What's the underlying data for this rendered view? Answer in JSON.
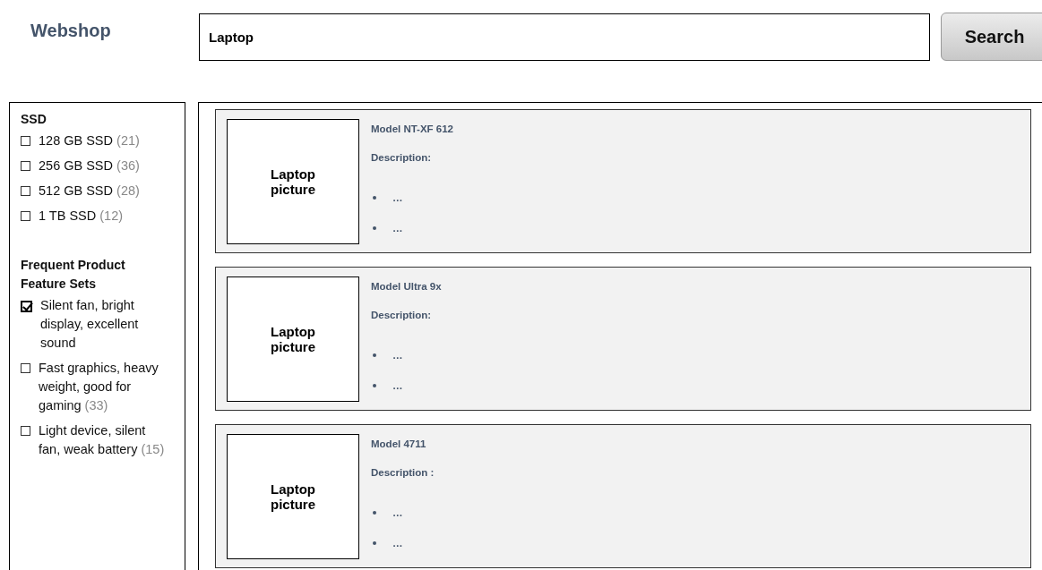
{
  "header": {
    "logo": "Webshop",
    "search": {
      "value": "Laptop"
    },
    "search_button": "Search"
  },
  "sidebar": {
    "groups": [
      {
        "title": "SSD",
        "options": [
          {
            "label": "128 GB SSD",
            "count": "(21)",
            "checked": false
          },
          {
            "label": "256 GB SSD",
            "count": "(36)",
            "checked": false
          },
          {
            "label": "512 GB SSD",
            "count": "(28)",
            "checked": false
          },
          {
            "label": "1 TB SSD",
            "count": "(12)",
            "checked": false
          }
        ]
      },
      {
        "title": "Frequent Product Feature Sets",
        "options": [
          {
            "label": "Silent fan, bright display, excellent sound",
            "checked": true
          },
          {
            "label": "Fast graphics, heavy weight, good for gaming",
            "count": "(33)",
            "checked": false
          },
          {
            "label": "Light device, silent fan, weak battery",
            "count": "(15)",
            "checked": false
          }
        ]
      }
    ]
  },
  "products": [
    {
      "picture_label": "Laptop picture",
      "model": "Model NT-XF 612",
      "description_label": "Description:",
      "bullets": [
        "…",
        "…"
      ]
    },
    {
      "picture_label": "Laptop picture",
      "model": "Model Ultra 9x",
      "description_label": "Description:",
      "bullets": [
        "…",
        "…"
      ]
    },
    {
      "picture_label": "Laptop picture",
      "model": "Model 4711",
      "description_label": "Description :",
      "bullets": [
        "…",
        "…"
      ]
    }
  ]
}
